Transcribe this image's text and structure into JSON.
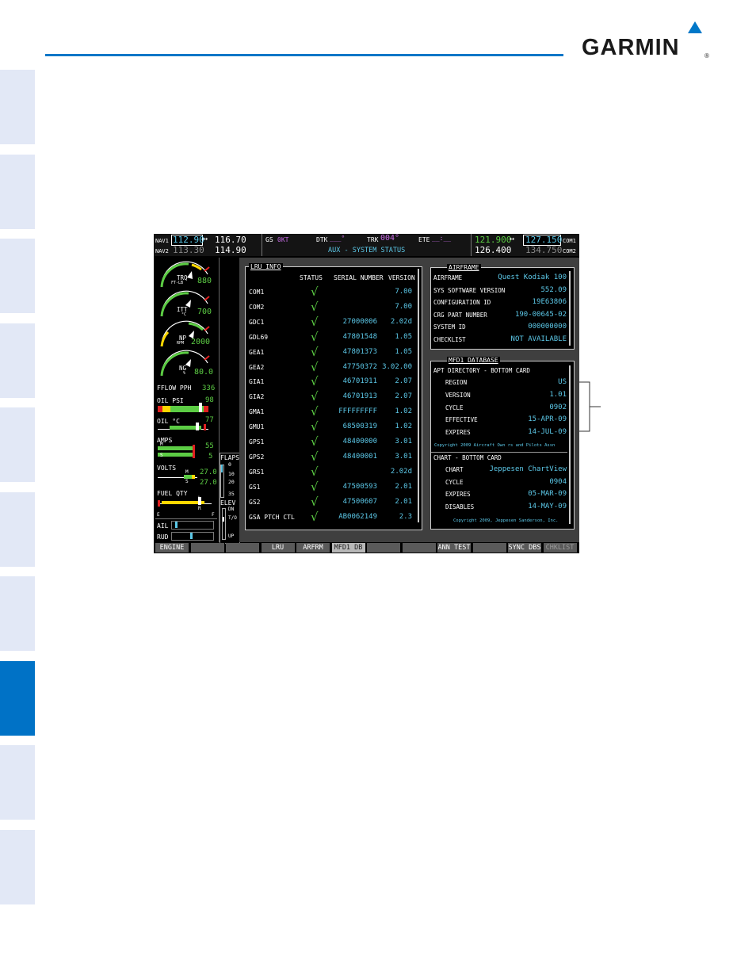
{
  "brand": {
    "name": "GARMIN",
    "reg": "®"
  },
  "colors": {
    "accent": "#0077c8",
    "side_tab": "#e2e8f6",
    "side_tab_active": "#0072c6",
    "lcd_cyan": "#5cc8e8",
    "lcd_green": "#5ccc44",
    "lcd_magenta": "#c86ce6"
  },
  "nav": {
    "nav1_label": "NAV1",
    "nav1_active": "112.90",
    "swap": "↔",
    "nav1_standby": "116.70",
    "nav2_label": "NAV2",
    "nav2_active": "113.30",
    "nav2_standby": "114.90"
  },
  "data_bar": {
    "gs_label": "GS",
    "gs_value": "0KT",
    "dtk_label": "DTK",
    "dtk_value": "___°",
    "trk_label": "TRK",
    "trk_value": "004°",
    "ete_label": "ETE",
    "ete_value": "__:__",
    "page_title": "AUX - SYSTEM STATUS"
  },
  "com": {
    "com1_active": "121.900",
    "swap": "↔",
    "com1_standby": "127.150",
    "com1_label": "COM1",
    "com2_active": "126.400",
    "com2_standby": "134.750",
    "com2_label": "COM2"
  },
  "engine": {
    "trq": {
      "label": "TRQ",
      "unit": "FT-LB",
      "value": "880"
    },
    "itt": {
      "label": "ITT",
      "unit": "°C",
      "value": "700"
    },
    "np": {
      "label": "NP",
      "unit": "RPM",
      "value": "2000"
    },
    "ng": {
      "label": "NG",
      "unit": "%",
      "value": "80.0"
    },
    "fflow": {
      "label": "FFLOW PPH",
      "value": "336"
    },
    "oil_psi": {
      "label": "OIL PSI",
      "value": "98"
    },
    "oil_c": {
      "label": "OIL °C",
      "value": "77"
    },
    "amps": {
      "label": "AMPS",
      "value1": "55",
      "value2": "5",
      "m1": "M",
      "m2": "S"
    },
    "volts": {
      "label": "VOLTS",
      "value1": "27.0",
      "value2": "27.0",
      "m1": "M",
      "m2": "S"
    },
    "fuel": {
      "label": "FUEL QTY",
      "e": "E",
      "f": "F",
      "left": "L",
      "right": "R"
    },
    "flaps": {
      "label": "FLAPS",
      "t0": "0",
      "t1": "10",
      "t2": "20",
      "t3": "35"
    },
    "elev": {
      "label": "ELEV",
      "dn": "DN",
      "to": "T/O",
      "up": "UP"
    },
    "ail": "AIL",
    "rud": "RUD"
  },
  "lru": {
    "title": "LRU INFO",
    "headers": {
      "status": "STATUS",
      "serial": "SERIAL NUMBER",
      "version": "VERSION"
    },
    "rows": [
      {
        "name": "COM1",
        "status": "√",
        "serial": "",
        "version": "7.00"
      },
      {
        "name": "COM2",
        "status": "√",
        "serial": "",
        "version": "7.00"
      },
      {
        "name": "GDC1",
        "status": "√",
        "serial": "27000006",
        "version": "2.02d"
      },
      {
        "name": "GDL69",
        "status": "√",
        "serial": "47801548",
        "version": "1.05"
      },
      {
        "name": "GEA1",
        "status": "√",
        "serial": "47801373",
        "version": "1.05"
      },
      {
        "name": "GEA2",
        "status": "√",
        "serial": "47750372",
        "version": "3.02.00"
      },
      {
        "name": "GIA1",
        "status": "√",
        "serial": "46701911",
        "version": "2.07"
      },
      {
        "name": "GIA2",
        "status": "√",
        "serial": "46701913",
        "version": "2.07"
      },
      {
        "name": "GMA1",
        "status": "√",
        "serial": "FFFFFFFFF",
        "version": "1.02"
      },
      {
        "name": "GMU1",
        "status": "√",
        "serial": "68500319",
        "version": "1.02"
      },
      {
        "name": "GPS1",
        "status": "√",
        "serial": "48400000",
        "version": "3.01"
      },
      {
        "name": "GPS2",
        "status": "√",
        "serial": "48400001",
        "version": "3.01"
      },
      {
        "name": "GRS1",
        "status": "√",
        "serial": "",
        "version": "2.02d"
      },
      {
        "name": "GS1",
        "status": "√",
        "serial": "47500593",
        "version": "2.01"
      },
      {
        "name": "GS2",
        "status": "√",
        "serial": "47500607",
        "version": "2.01"
      },
      {
        "name": "GSA PTCH CTL",
        "status": "√",
        "serial": "AB0062149",
        "version": "2.3"
      }
    ]
  },
  "airframe": {
    "title": "AIRFRAME",
    "rows": [
      {
        "label": "AIRFRAME",
        "value": "Quest Kodiak 100"
      },
      {
        "label": "SYS SOFTWARE VERSION",
        "value": "552.09"
      },
      {
        "label": "CONFIGURATION ID",
        "value": "19E63806"
      },
      {
        "label": "CRG PART NUMBER",
        "value": "190-00645-02"
      },
      {
        "label": "SYSTEM ID",
        "value": "000000000"
      },
      {
        "label": "CHECKLIST",
        "value": "NOT AVAILABLE"
      }
    ]
  },
  "mfd_db": {
    "title": "MFD1 DATABASE",
    "apt_header": "APT DIRECTORY - BOTTOM CARD",
    "apt_rows": [
      {
        "label": "REGION",
        "value": "US"
      },
      {
        "label": "VERSION",
        "value": "1.01"
      },
      {
        "label": "CYCLE",
        "value": "0902"
      },
      {
        "label": "EFFECTIVE",
        "value": "15-APR-09"
      },
      {
        "label": "EXPIRES",
        "value": "14-JUL-09"
      }
    ],
    "apt_copyright": "Copyright 2009 Aircraft Own rs and Pilots Assn",
    "chart_header": "CHART - BOTTOM CARD",
    "chart_rows": [
      {
        "label": "CHART",
        "value": "Jeppesen ChartView"
      },
      {
        "label": "CYCLE",
        "value": "0904"
      },
      {
        "label": "EXPIRES",
        "value": "05-MAR-09"
      },
      {
        "label": "DISABLES",
        "value": "14-MAY-09"
      }
    ],
    "chart_copyright": "Copyright 2009, Jeppesen Sanderson, Inc."
  },
  "softkeys": [
    "ENGINE",
    "",
    "",
    "LRU",
    "ARFRM",
    "MFD1 DB",
    "",
    "",
    "ANN TEST",
    "",
    "SYNC DBS",
    "CHKLIST"
  ]
}
